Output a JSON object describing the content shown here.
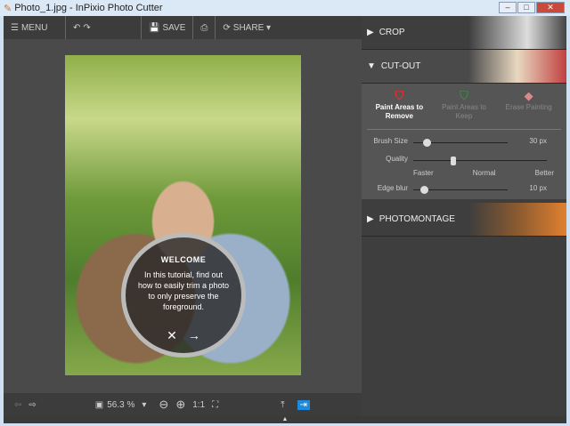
{
  "window": {
    "title": "Photo_1.jpg - InPixio Photo Cutter",
    "min": "–",
    "max": "□",
    "close": "✕"
  },
  "toolbar": {
    "menu": "MENU",
    "save": "SAVE",
    "share": "SHARE ▾"
  },
  "welcome": {
    "title": "WELCOME",
    "text": "In this tutorial, find out how to easily trim a photo to only preserve the foreground.",
    "close": "✕",
    "next": "→"
  },
  "bottom": {
    "zoom": "56.3 %",
    "zoom_caret": "▾",
    "one_to_one": "1:1",
    "collapse": "▲"
  },
  "sidebar": {
    "crop": "CROP",
    "cutout": "CUT-OUT",
    "photomontage": "PHOTOMONTAGE",
    "modes": [
      {
        "label": "Paint Areas to Remove"
      },
      {
        "label": "Paint Areas to Keep"
      },
      {
        "label": "Erase Painting"
      }
    ],
    "brush_size": {
      "label": "Brush Size",
      "value": "30 px",
      "fraction": 0.1
    },
    "quality": {
      "label": "Quality",
      "ticks": [
        "Faster",
        "Normal",
        "Better"
      ],
      "fraction": 0.28
    },
    "edge_blur": {
      "label": "Edge blur",
      "value": "10 px",
      "fraction": 0.08
    }
  }
}
